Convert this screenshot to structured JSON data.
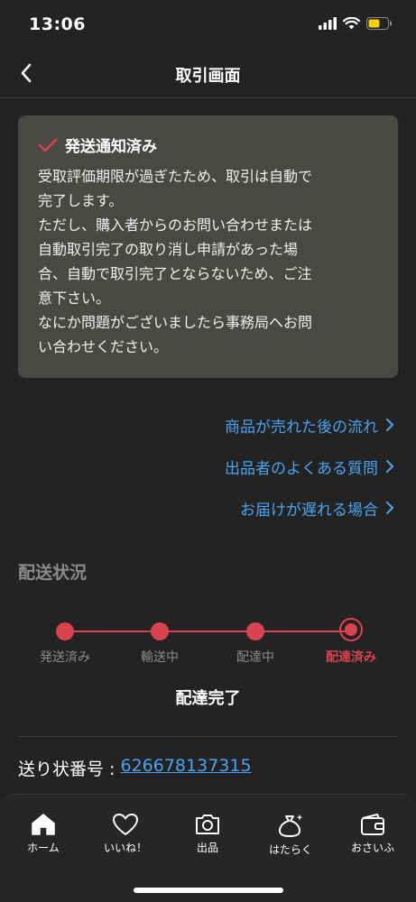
{
  "status_bar": {
    "time": "13:06"
  },
  "nav": {
    "title": "取引画面"
  },
  "notice": {
    "title": "発送通知済み",
    "body": "受取評価期限が過ぎたため、取引は自動で\n完了します。\nただし、購入者からのお問い合わせまたは\n自動取引完了の取り消し申請があった場\n合、自動で取引完了とならないため、ご注\n意下さい。\nなにか問題がございましたら事務局へお問\nい合わせください。"
  },
  "links": [
    {
      "label": "商品が売れた後の流れ"
    },
    {
      "label": "出品者のよくある質問"
    },
    {
      "label": "お届けが遅れる場合"
    }
  ],
  "shipping": {
    "section_title": "配送状況",
    "steps": [
      {
        "label": "発送済み"
      },
      {
        "label": "輸送中"
      },
      {
        "label": "配達中"
      },
      {
        "label": "配達済み"
      }
    ],
    "current_step": 4,
    "status_text": "配達完了",
    "tracking_label": "送り状番号 : ",
    "tracking_number": "626678137315"
  },
  "tabs": [
    {
      "label": "ホーム",
      "icon": "home-icon"
    },
    {
      "label": "いいね！",
      "icon": "heart-icon"
    },
    {
      "label": "出品",
      "icon": "camera-icon"
    },
    {
      "label": "はたらく",
      "icon": "money-bag-icon"
    },
    {
      "label": "おさいふ",
      "icon": "wallet-icon"
    }
  ],
  "colors": {
    "accent": "#d8434f",
    "link": "#4aa3f0",
    "background": "#232323",
    "notice_bg": "#4a4844"
  }
}
